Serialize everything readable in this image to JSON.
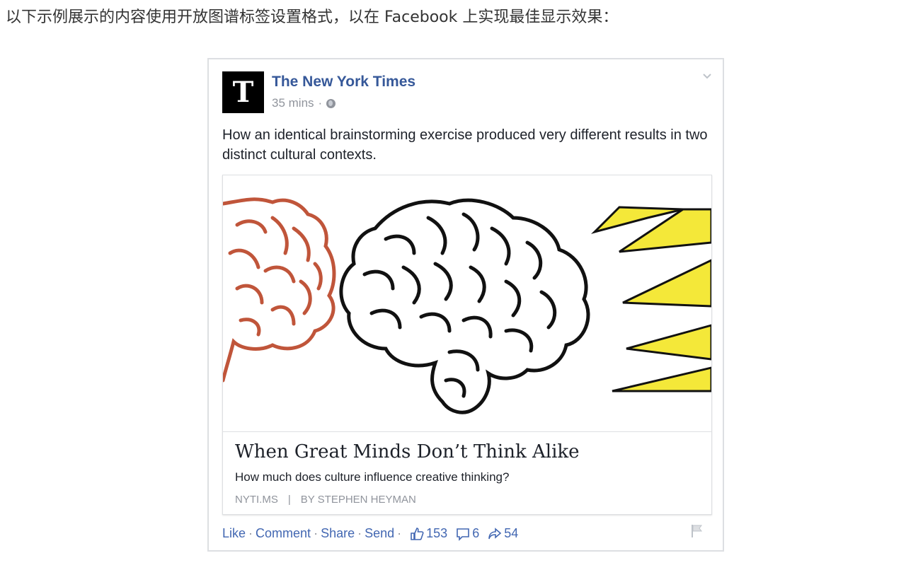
{
  "intro": {
    "text": "以下示例展示的内容使用开放图谱标签设置格式，以在 Facebook 上实现最佳显示效果："
  },
  "post": {
    "logo_letter": "T",
    "page_name": "The New York Times",
    "time": "35 mins",
    "meta_sep": "·",
    "text": "How an identical brainstorming exercise produced very different results in two distinct cultural contexts.",
    "link_card": {
      "title": "When Great Minds Don’t Think Alike",
      "description": "How much does culture influence creative thinking?",
      "domain": "NYTI.MS",
      "separator": "|",
      "byline": "BY STEPHEN HEYMAN"
    },
    "actions": {
      "like": "Like",
      "comment": "Comment",
      "share": "Share",
      "send": "Send",
      "dot": "·",
      "likes_count": "153",
      "comments_count": "6",
      "shares_count": "54"
    },
    "colors": {
      "link_blue": "#4267b2",
      "name_blue": "#365899",
      "brain_red": "#c0553a",
      "bolt_yellow": "#f4e839"
    }
  }
}
